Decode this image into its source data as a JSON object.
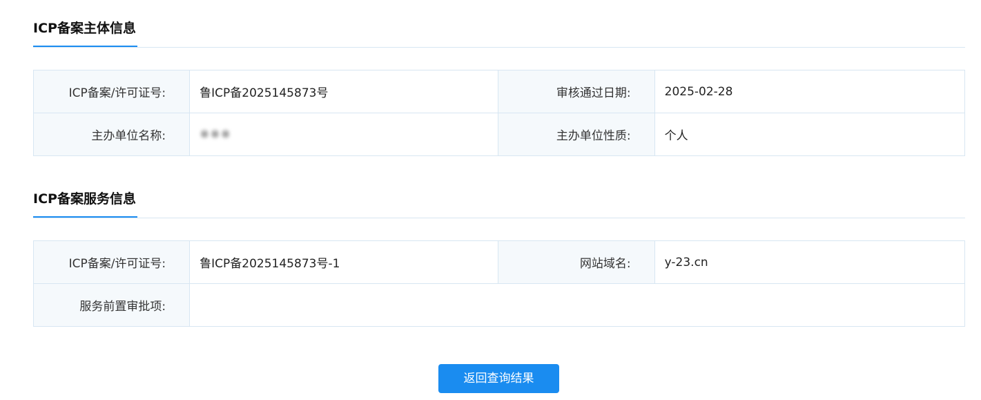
{
  "subject_section": {
    "title": "ICP备案主体信息",
    "rows": [
      {
        "label1": "ICP备案/许可证号:",
        "value1": "鲁ICP备2025145873号",
        "label2": "审核通过日期:",
        "value2": "2025-02-28"
      },
      {
        "label1": "主办单位名称:",
        "value1": "※※※",
        "label2": "主办单位性质:",
        "value2": "个人"
      }
    ]
  },
  "service_section": {
    "title": "ICP备案服务信息",
    "rows": [
      {
        "label1": "ICP备案/许可证号:",
        "value1": "鲁ICP备2025145873号-1",
        "label2": "网站域名:",
        "value2": "y-23.cn"
      },
      {
        "label1": "服务前置审批项:",
        "value1": ""
      }
    ]
  },
  "actions": {
    "return_label": "返回查询结果"
  },
  "colors": {
    "accent": "#1a8cf0",
    "border": "#d7e6f2",
    "label_bg": "#f5f9fc"
  }
}
